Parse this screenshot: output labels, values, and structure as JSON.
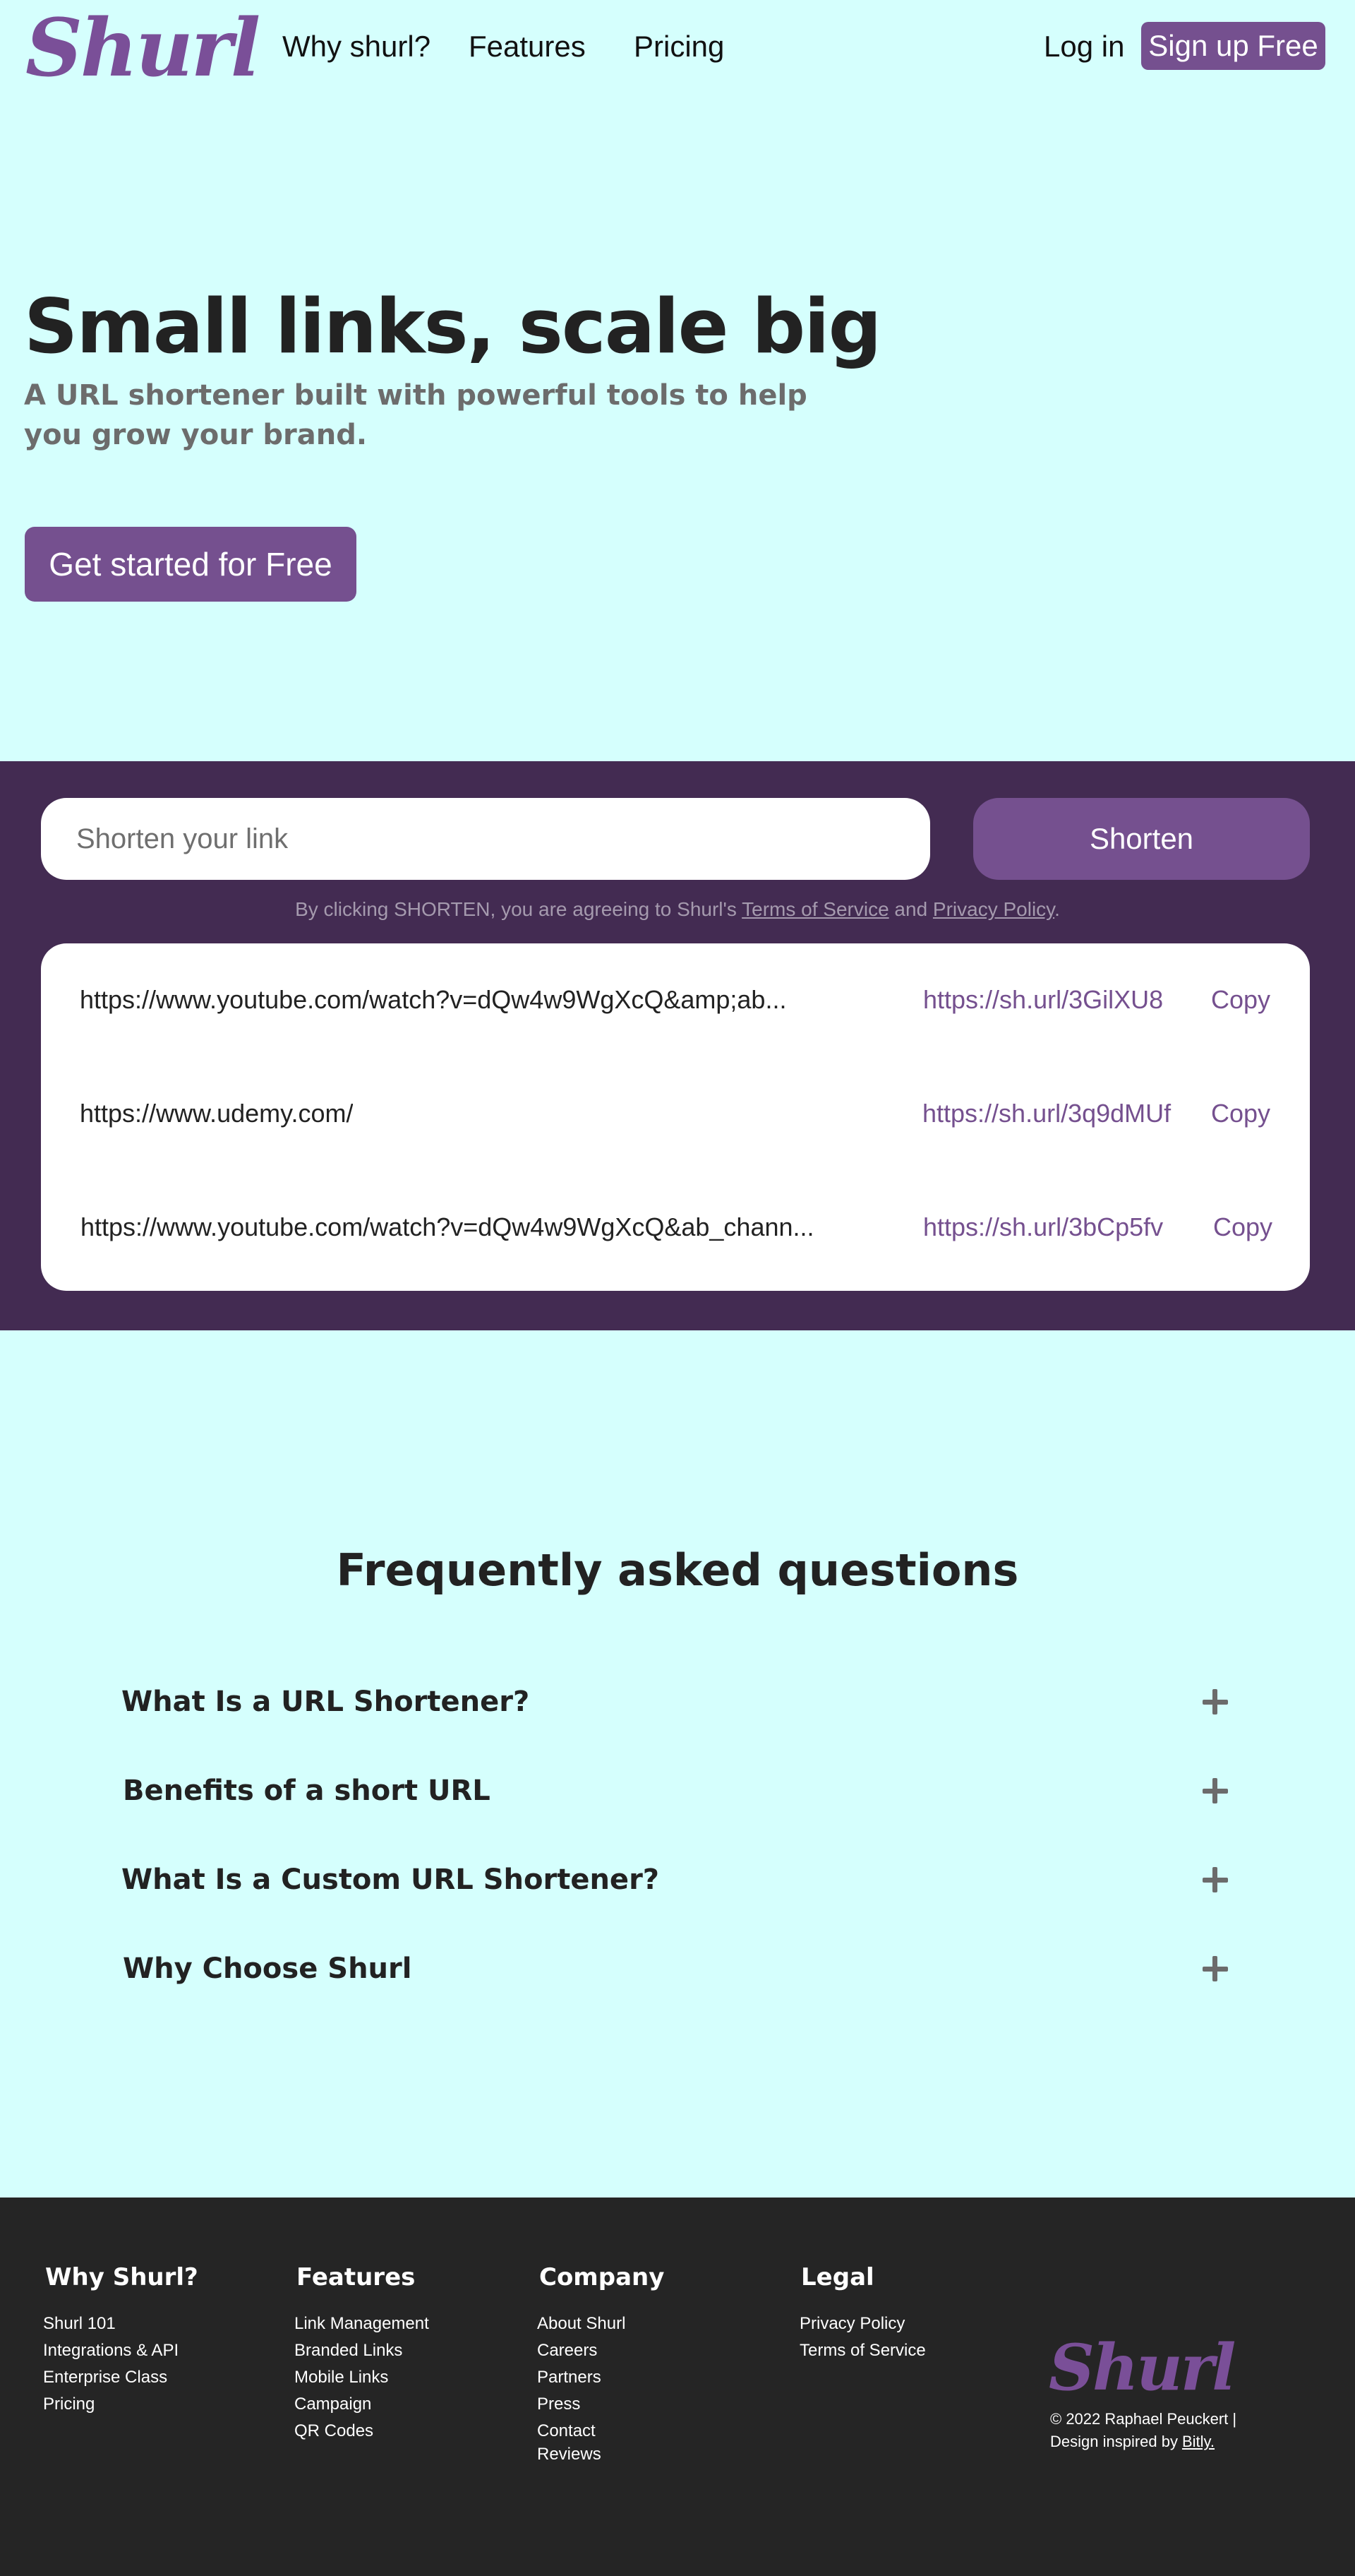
{
  "nav": {
    "logo": "Shurl",
    "links": [
      "Why shurl?",
      "Features",
      "Pricing"
    ],
    "login": "Log in",
    "signup": "Sign up Free"
  },
  "hero": {
    "title": "Small links, scale big",
    "subtitle": "A URL shortener built with powerful tools to help you grow your brand.",
    "cta": "Get started for Free"
  },
  "shorten": {
    "placeholder": "Shorten your link",
    "button": "Shorten",
    "disclaimer_prefix": "By clicking SHORTEN, you are agreeing to Shurl's ",
    "terms": "Terms of Service",
    "disclaimer_and": " and ",
    "privacy": "Privacy Policy",
    "disclaimer_suffix": ".",
    "links": [
      {
        "long": "https://www.youtube.com/watch?v=dQw4w9WgXcQ&amp;ab...",
        "short": "https://sh.url/3GilXU8",
        "copy": "Copy"
      },
      {
        "long": "https://www.udemy.com/",
        "short": "https://sh.url/3q9dMUf",
        "copy": "Copy"
      },
      {
        "long": "https://www.youtube.com/watch?v=dQw4w9WgXcQ&ab_chann...",
        "short": "https://sh.url/3bCp5fv",
        "copy": "Copy"
      }
    ]
  },
  "faq": {
    "title": "Frequently asked questions",
    "items": [
      {
        "question": "What Is a URL Shortener?",
        "icon": "plus-icon"
      },
      {
        "question": "Benefits of a short URL",
        "icon": "plus-icon"
      },
      {
        "question": "What Is a Custom URL Shortener?",
        "icon": "plus-icon"
      },
      {
        "question": "Why Choose Shurl",
        "icon": "plus-icon"
      }
    ]
  },
  "footer": {
    "columns": [
      {
        "heading": "Why Shurl?",
        "links": [
          "Shurl 101",
          "Integrations & API",
          "Enterprise Class",
          "Pricing"
        ]
      },
      {
        "heading": "Features",
        "links": [
          "Link Management",
          "Branded Links",
          "Mobile Links",
          "Campaign",
          "QR Codes"
        ]
      },
      {
        "heading": "Company",
        "links": [
          "About Shurl",
          "Careers",
          "Partners",
          "Press",
          "Contact",
          "Reviews"
        ]
      },
      {
        "heading": "Legal",
        "links": [
          "Privacy Policy",
          "Terms of Service"
        ]
      }
    ],
    "logo": "Shurl",
    "copyright": "© 2022 Raphael Peuckert |",
    "inspired_prefix": "Design inspired by",
    "inspired_link": "Bitly."
  },
  "colors": {
    "background": "#d5fffd",
    "brand_purple": "#75508f",
    "section_purple": "#432b52",
    "footer_bg": "#252525"
  }
}
